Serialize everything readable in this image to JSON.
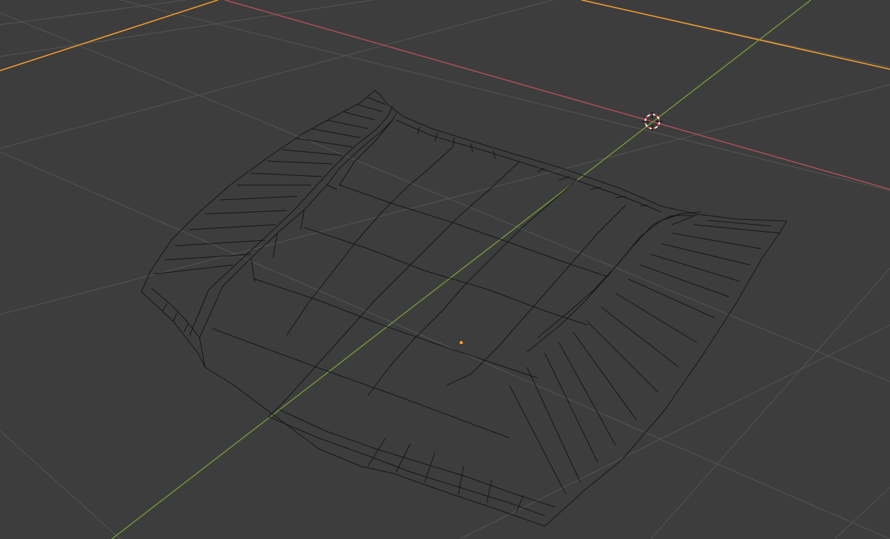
{
  "app": "3D Viewport",
  "view": {
    "shading": "wireframe",
    "mode": "edit-mesh",
    "background_color": "#3d3d3d",
    "grid_color": "#545454",
    "axis_x_color": "#c8545f",
    "axis_y_color": "#7ba33b",
    "selection_outline_color": "#f59e2f",
    "wire_color": "#111111",
    "origin_color": "#f59e2f"
  },
  "scene": {
    "object": "mesh-wireframe",
    "cursor": "3d-cursor-icon",
    "origin": "object-origin-dot"
  }
}
